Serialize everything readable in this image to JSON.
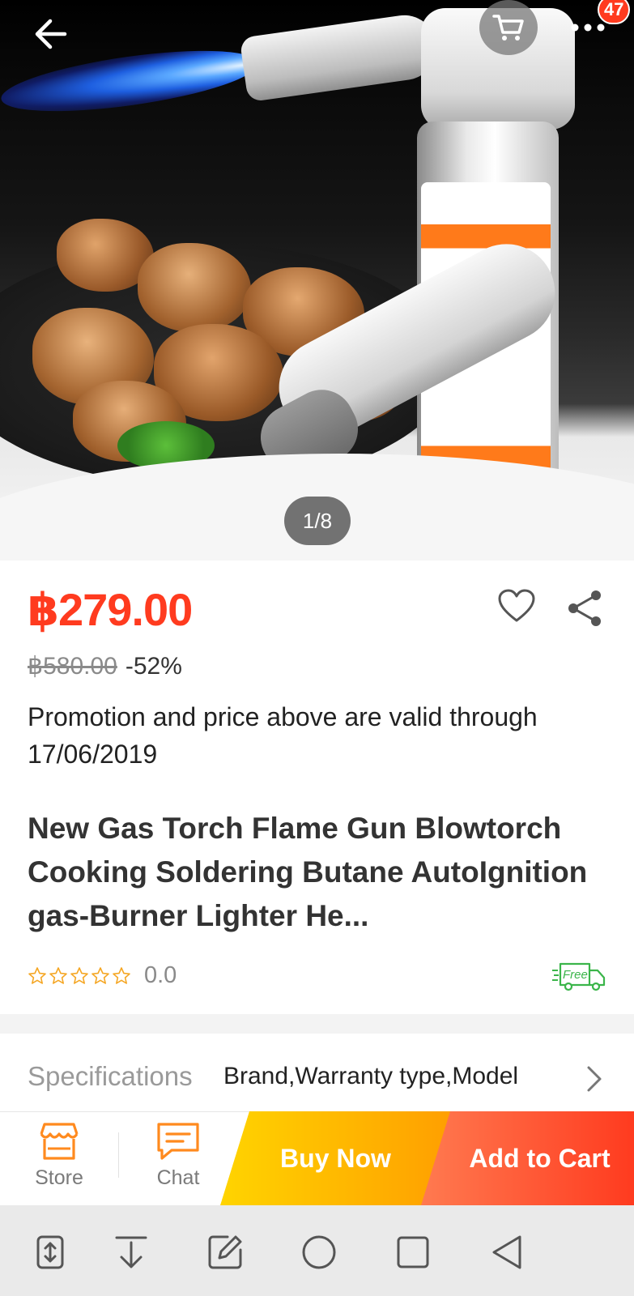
{
  "gallery": {
    "page_indicator": "1/8",
    "cart_badge_count": "47",
    "icons": [
      "back-arrow-icon",
      "cart-icon",
      "more-icon"
    ]
  },
  "product": {
    "price": "฿279.00",
    "original_price": "฿580.00",
    "discount": "-52%",
    "promotion_text": "Promotion and price above are valid through 17/06/2019",
    "title": "New Gas Torch Flame Gun Blowtorch Cooking Soldering Butane AutoIgnition gas-Burner Lighter He...",
    "rating_value": "0.0",
    "star_count_filled": 0,
    "free_shipping_label": "Free"
  },
  "specifications": {
    "label": "Specifications",
    "value": "Brand,Warranty type,Model"
  },
  "action_bar": {
    "store_label": "Store",
    "chat_label": "Chat",
    "buy_now_label": "Buy Now",
    "add_to_cart_label": "Add to Cart"
  },
  "colors": {
    "price": "#ff3b1f",
    "buy_now_gradient": [
      "#ffd400",
      "#ff9f00"
    ],
    "add_to_cart_gradient": [
      "#ff7a50",
      "#ff3b1f"
    ],
    "free_shipping": "#3bb54a",
    "star_outline": "#f5a623"
  },
  "system_nav": {
    "icons": [
      "screenshot-icon",
      "download-icon",
      "edit-icon",
      "home-icon",
      "recents-icon",
      "back-icon"
    ]
  }
}
